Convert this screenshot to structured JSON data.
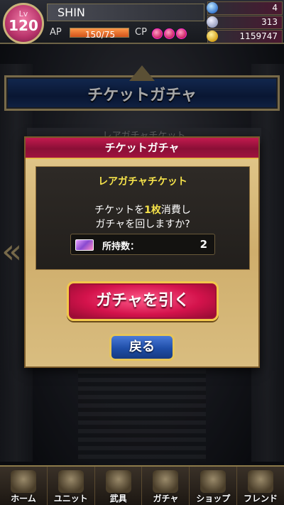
{
  "player": {
    "level_label": "Lv",
    "level": "120",
    "name": "SHIN",
    "ap_label": "AP",
    "ap_text": "150/75",
    "ap_fill_fraction": 1.0,
    "cp_label": "CP",
    "cp_count": 3
  },
  "currencies": [
    {
      "icon": "gem-icon",
      "value": "4"
    },
    {
      "icon": "crystal-icon",
      "value": "313"
    },
    {
      "icon": "gold-coin-icon",
      "value": "1159747"
    }
  ],
  "page": {
    "title": "チケットガチャ",
    "behind_label": "レアガチャチケット"
  },
  "dialog": {
    "header": "チケットガチャ",
    "ticket_name": "レアガチャチケット",
    "confirm_prefix": "チケットを",
    "confirm_count": "1枚",
    "confirm_suffix": "消費し",
    "confirm_line2": "ガチャを回しますか?",
    "owned_label": "所持数：",
    "owned_value": "2",
    "pull_button": "ガチャを引く",
    "back_button": "戻る"
  },
  "nav": [
    {
      "label": "ホーム",
      "icon": "home-icon"
    },
    {
      "label": "ユニット",
      "icon": "unit-icon"
    },
    {
      "label": "武具",
      "icon": "weapon-icon"
    },
    {
      "label": "ガチャ",
      "icon": "gacha-crystal-icon"
    },
    {
      "label": "ショップ",
      "icon": "shop-icon"
    },
    {
      "label": "フレンド",
      "icon": "friend-icon"
    }
  ],
  "colors": {
    "dialog_header": "#c21a4e",
    "highlight_text": "#f5e24a",
    "pull_button": "#d4134c",
    "back_button": "#1f4ea8",
    "banner": "#1d3e7a"
  }
}
